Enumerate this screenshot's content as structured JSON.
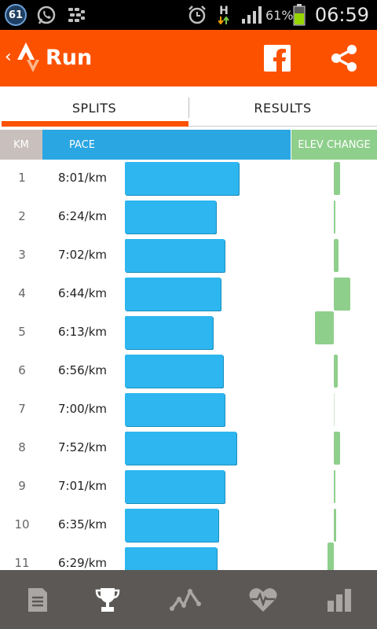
{
  "status_bar": {
    "notification_count": "61",
    "network_type": "H",
    "battery_percent": "61%",
    "time": "06:59",
    "icons": [
      "whatsapp-icon",
      "blackberry-messenger-icon",
      "alarm-icon",
      "signal-icon",
      "battery-icon"
    ]
  },
  "toolbar": {
    "back_glyph": "‹",
    "title": "Run",
    "icons": [
      "strava-logo-icon",
      "facebook-icon",
      "share-icon"
    ],
    "colors": {
      "background": "#fc5200"
    }
  },
  "tabs": [
    {
      "label": "SPLITS",
      "selected": true
    },
    {
      "label": "RESULTS",
      "selected": false
    }
  ],
  "columns": {
    "km": "KM",
    "pace": "PACE",
    "elev": "ELEV CHANGE",
    "colors": {
      "km": "#c9c0bd",
      "pace": "#2aa6e2",
      "elev": "#8fcf8c"
    }
  },
  "splits": [
    {
      "km": "1",
      "pace": "8:01/km",
      "pace_seconds": 481,
      "elev": 0.25
    },
    {
      "km": "2",
      "pace": "6:24/km",
      "pace_seconds": 384,
      "elev": 0.05
    },
    {
      "km": "3",
      "pace": "7:02/km",
      "pace_seconds": 422,
      "elev": 0.2
    },
    {
      "km": "4",
      "pace": "6:44/km",
      "pace_seconds": 404,
      "elev": 0.7
    },
    {
      "km": "5",
      "pace": "6:13/km",
      "pace_seconds": 373,
      "elev": -0.8
    },
    {
      "km": "6",
      "pace": "6:56/km",
      "pace_seconds": 416,
      "elev": 0.15
    },
    {
      "km": "7",
      "pace": "7:00/km",
      "pace_seconds": 420,
      "elev": 0.0
    },
    {
      "km": "8",
      "pace": "7:52/km",
      "pace_seconds": 472,
      "elev": 0.25
    },
    {
      "km": "9",
      "pace": "7:01/km",
      "pace_seconds": 421,
      "elev": 0.05
    },
    {
      "km": "10",
      "pace": "6:35/km",
      "pace_seconds": 395,
      "elev": 0.1
    },
    {
      "km": "11",
      "pace": "6:29/km",
      "pace_seconds": 389,
      "elev": -0.25
    }
  ],
  "bottom_nav": [
    {
      "icon": "document-icon",
      "selected": false
    },
    {
      "icon": "trophy-icon",
      "selected": true
    },
    {
      "icon": "activity-graph-icon",
      "selected": false
    },
    {
      "icon": "heart-rate-icon",
      "selected": false
    },
    {
      "icon": "bar-chart-icon",
      "selected": false
    }
  ]
}
